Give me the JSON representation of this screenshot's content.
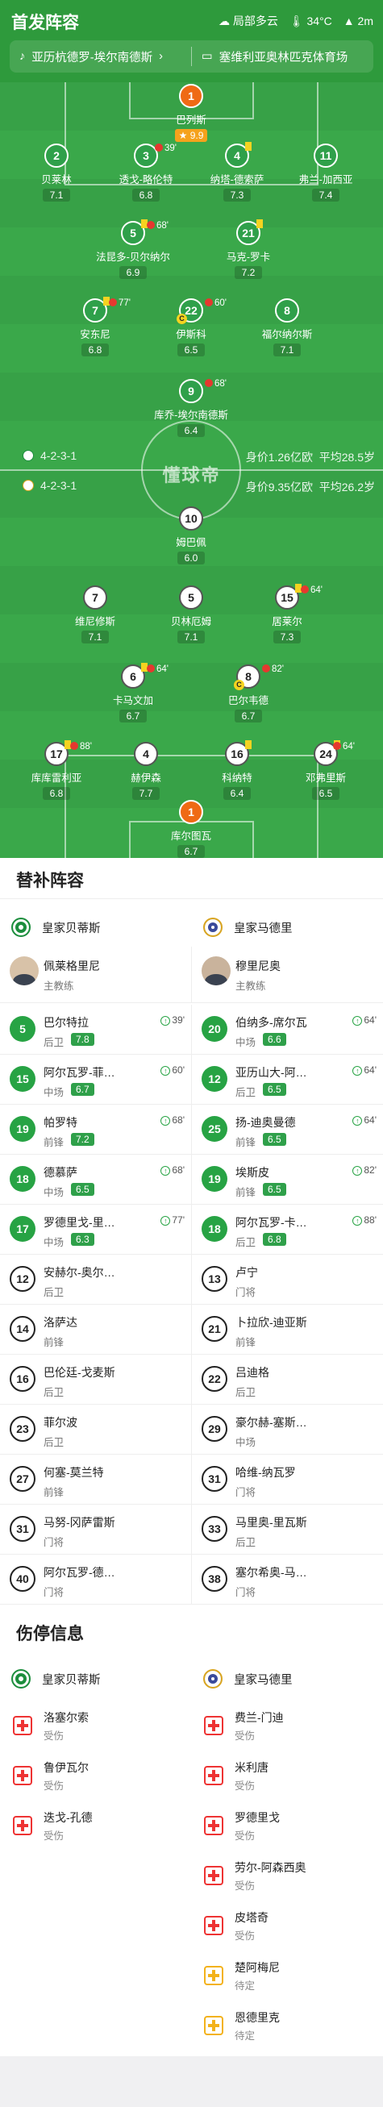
{
  "header": {
    "title": "首发阵容",
    "weather": "局部多云",
    "temperature": "34°C",
    "wind": "2m",
    "matchup": "亚历杭德罗-埃尔南德斯",
    "venue": "塞维利亚奥林匹克体育场"
  },
  "pitch": {
    "watermark": "懂球帝",
    "home_formation": "4-2-3-1",
    "home_value": "身价1.26亿欧",
    "home_age": "平均28.5岁",
    "away_formation": "4-2-3-1",
    "away_value": "身价9.35亿欧",
    "away_age": "平均26.2岁"
  },
  "home_players": [
    {
      "num": "1",
      "name": "巴列斯",
      "rating": "9.9",
      "star": true
    },
    {
      "num": "2",
      "name": "贝莱林",
      "rating": "7.1"
    },
    {
      "num": "3",
      "name": "透戈-略伦特",
      "rating": "6.8",
      "sub": "39'"
    },
    {
      "num": "4",
      "name": "纳塔-德索萨",
      "rating": "7.3"
    },
    {
      "num": "11",
      "name": "弗兰-加西亚",
      "rating": "7.4"
    },
    {
      "num": "5",
      "name": "法昆多-贝尔纳尔",
      "rating": "6.9",
      "sub": "68'"
    },
    {
      "num": "21",
      "name": "马克-罗卡",
      "rating": "7.2"
    },
    {
      "num": "7",
      "name": "安东尼",
      "rating": "6.8",
      "sub": "77'"
    },
    {
      "num": "22",
      "name": "伊斯科",
      "rating": "6.5",
      "sub": "60'"
    },
    {
      "num": "8",
      "name": "福尔纳尔斯",
      "rating": "7.1"
    },
    {
      "num": "9",
      "name": "库乔-埃尔南德斯",
      "rating": "6.4",
      "sub": "68'"
    }
  ],
  "away_players": [
    {
      "num": "10",
      "name": "姆巴佩",
      "rating": "6.0"
    },
    {
      "num": "7",
      "name": "维尼修斯",
      "rating": "7.1"
    },
    {
      "num": "5",
      "name": "贝林厄姆",
      "rating": "7.1"
    },
    {
      "num": "15",
      "name": "居莱尔",
      "rating": "7.3",
      "sub": "64'"
    },
    {
      "num": "6",
      "name": "卡马文加",
      "rating": "6.7",
      "sub": "64'"
    },
    {
      "num": "8",
      "name": "巴尔韦德",
      "rating": "6.7",
      "sub": "82'"
    },
    {
      "num": "17",
      "name": "库库雷利亚",
      "rating": "6.8",
      "sub": "88'"
    },
    {
      "num": "4",
      "name": "赫伊森",
      "rating": "7.7"
    },
    {
      "num": "16",
      "name": "科纳特",
      "rating": "6.4"
    },
    {
      "num": "24",
      "name": "邓弗里斯",
      "rating": "6.5",
      "sub": "64'"
    },
    {
      "num": "1",
      "name": "库尔图瓦",
      "rating": "6.7"
    }
  ],
  "subs_section": {
    "title": "替补阵容",
    "home_team": "皇家贝蒂斯",
    "away_team": "皇家马德里",
    "home_coach": "佩莱格里尼",
    "away_coach": "穆里尼奥",
    "coach_label": "主教练"
  },
  "home_subs": [
    {
      "num": "5",
      "name": "巴尔特拉",
      "pos": "后卫",
      "rating": "7.8",
      "min": "39'"
    },
    {
      "num": "15",
      "name": "阿尔瓦罗-菲…",
      "pos": "中场",
      "rating": "6.7",
      "min": "60'"
    },
    {
      "num": "19",
      "name": "帕罗特",
      "pos": "前锋",
      "rating": "7.2",
      "min": "68'"
    },
    {
      "num": "18",
      "name": "德慕萨",
      "pos": "中场",
      "rating": "6.5",
      "min": "68'"
    },
    {
      "num": "17",
      "name": "罗德里戈-里…",
      "pos": "中场",
      "rating": "6.3",
      "min": "77'"
    },
    {
      "num": "12",
      "name": "安赫尔-奥尔…",
      "pos": "后卫"
    },
    {
      "num": "14",
      "name": "洛萨达",
      "pos": "前锋"
    },
    {
      "num": "16",
      "name": "巴伦廷-戈麦斯",
      "pos": "后卫"
    },
    {
      "num": "23",
      "name": "菲尔波",
      "pos": "后卫"
    },
    {
      "num": "27",
      "name": "何塞-莫兰特",
      "pos": "前锋"
    },
    {
      "num": "31",
      "name": "马努-冈萨雷斯",
      "pos": "门将"
    },
    {
      "num": "40",
      "name": "阿尔瓦罗-德…",
      "pos": "门将"
    }
  ],
  "away_subs": [
    {
      "num": "20",
      "name": "伯纳多-席尔瓦",
      "pos": "中场",
      "rating": "6.6",
      "min": "64'"
    },
    {
      "num": "12",
      "name": "亚历山大-阿…",
      "pos": "后卫",
      "rating": "6.5",
      "min": "64'"
    },
    {
      "num": "25",
      "name": "扬-迪奥曼德",
      "pos": "前锋",
      "rating": "6.5",
      "min": "64'"
    },
    {
      "num": "19",
      "name": "埃斯皮",
      "pos": "前锋",
      "rating": "6.5",
      "min": "82'"
    },
    {
      "num": "18",
      "name": "阿尔瓦罗-卡…",
      "pos": "后卫",
      "rating": "6.8",
      "min": "88'"
    },
    {
      "num": "13",
      "name": "卢宁",
      "pos": "门将"
    },
    {
      "num": "21",
      "name": "卜拉欣-迪亚斯",
      "pos": "前锋"
    },
    {
      "num": "22",
      "name": "吕迪格",
      "pos": "后卫"
    },
    {
      "num": "29",
      "name": "豪尔赫-塞斯…",
      "pos": "中场"
    },
    {
      "num": "31",
      "name": "哈维-纳瓦罗",
      "pos": "门将"
    },
    {
      "num": "33",
      "name": "马里奥-里瓦斯",
      "pos": "后卫"
    },
    {
      "num": "38",
      "name": "塞尔希奥-马…",
      "pos": "门将"
    }
  ],
  "injury_section": {
    "title": "伤停信息",
    "home_team": "皇家贝蒂斯",
    "away_team": "皇家马德里"
  },
  "home_injuries": [
    {
      "name": "洛塞尔索",
      "status": "受伤"
    },
    {
      "name": "鲁伊瓦尔",
      "status": "受伤"
    },
    {
      "name": "迭戈-孔德",
      "status": "受伤"
    }
  ],
  "away_injuries": [
    {
      "name": "费兰-门迪",
      "status": "受伤"
    },
    {
      "name": "米利唐",
      "status": "受伤"
    },
    {
      "name": "罗德里戈",
      "status": "受伤"
    },
    {
      "name": "劳尔-阿森西奥",
      "status": "受伤"
    },
    {
      "name": "皮塔奇",
      "status": "受伤"
    },
    {
      "name": "楚阿梅尼",
      "status": "待定"
    },
    {
      "name": "恩德里克",
      "status": "待定"
    }
  ]
}
